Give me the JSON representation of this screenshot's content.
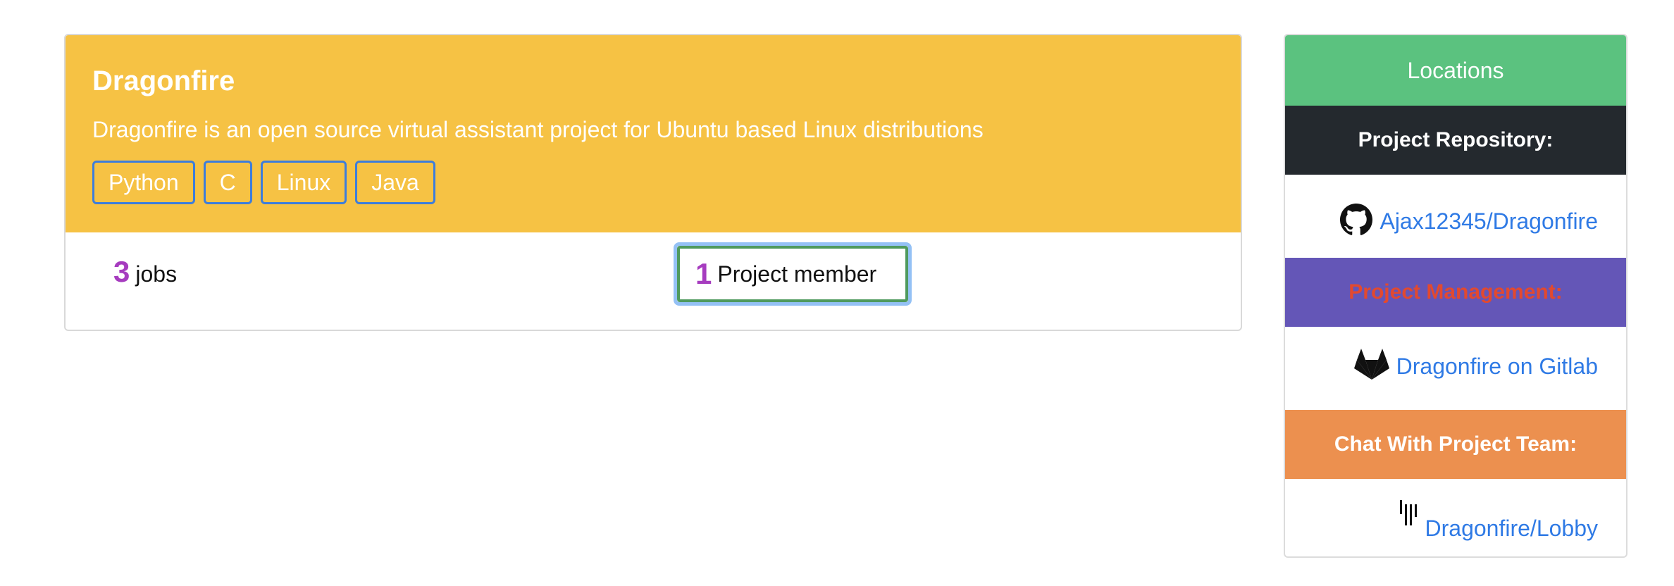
{
  "project": {
    "title": "Dragonfire",
    "description": "Dragonfire is an open source virtual assistant project for Ubuntu based Linux distributions",
    "tags": [
      "Python",
      "C",
      "Linux",
      "Java"
    ],
    "jobs_count": "3",
    "jobs_label": "jobs",
    "members_count": "1",
    "members_label": "Project member"
  },
  "locations": {
    "header": "Locations",
    "repository": {
      "title": "Project Repository:",
      "icon": "github-icon",
      "link_text": "Ajax12345/Dragonfire"
    },
    "management": {
      "title": "Project Management:",
      "icon": "gitlab-icon",
      "link_text": "Dragonfire on Gitlab"
    },
    "chat": {
      "title": "Chat With Project Team:",
      "icon": "gitter-icon",
      "link_text": "Dragonfire/Lobby"
    }
  },
  "colors": {
    "project_header": "#f6c244",
    "tag_border": "#3d7ddb",
    "count_accent": "#a63cbf",
    "member_border": "#4f9a5e",
    "focus_ring": "#94c1f5",
    "locations_header": "#5bc27f",
    "repository_header": "#24292e",
    "management_header": "#6456b7",
    "management_text": "#e2492f",
    "chat_header": "#ec904f",
    "link": "#2f7ae5"
  }
}
